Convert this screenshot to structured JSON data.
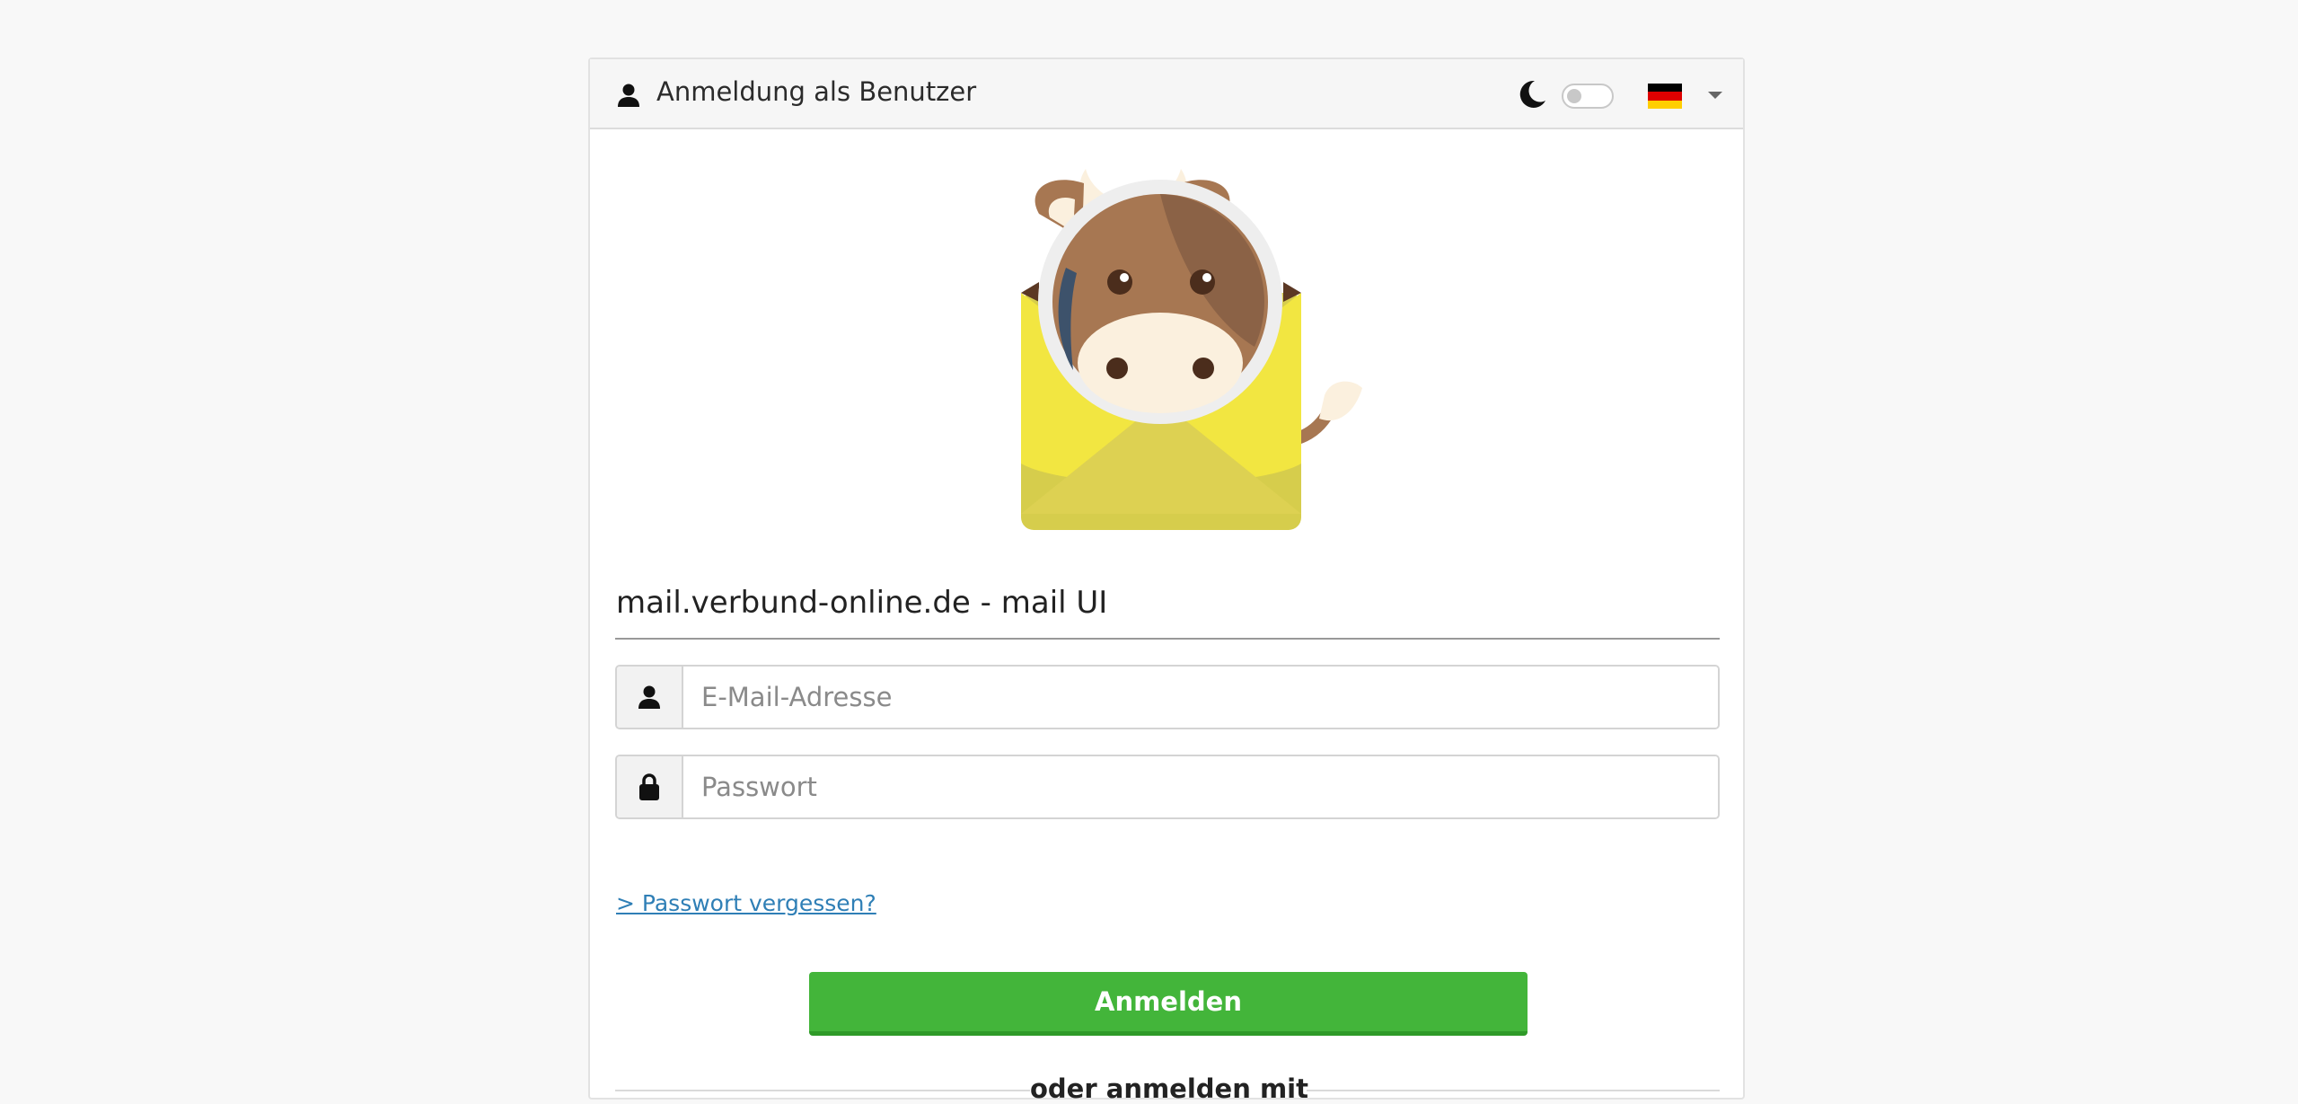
{
  "header": {
    "title": "Anmeldung als Benutzer",
    "dark_mode_enabled": false,
    "language": "Deutsch"
  },
  "site_title": "mail.verbund-online.de - mail UI",
  "form": {
    "email_placeholder": "E-Mail-Adresse",
    "password_placeholder": "Passwort",
    "forgot_password": "> Passwort vergessen?",
    "submit_label": "Anmelden"
  },
  "divider_text": "oder anmelden mit",
  "colors": {
    "primary_button": "#43b53a",
    "link": "#2f7fb6",
    "flag_black": "#000000",
    "flag_red": "#dd0000",
    "flag_gold": "#ffce00"
  },
  "icons": {
    "header": "user-icon",
    "theme": "moon-icon",
    "email_addon": "user-icon",
    "password_addon": "lock-icon",
    "language_dropdown": "chevron-down-icon"
  }
}
